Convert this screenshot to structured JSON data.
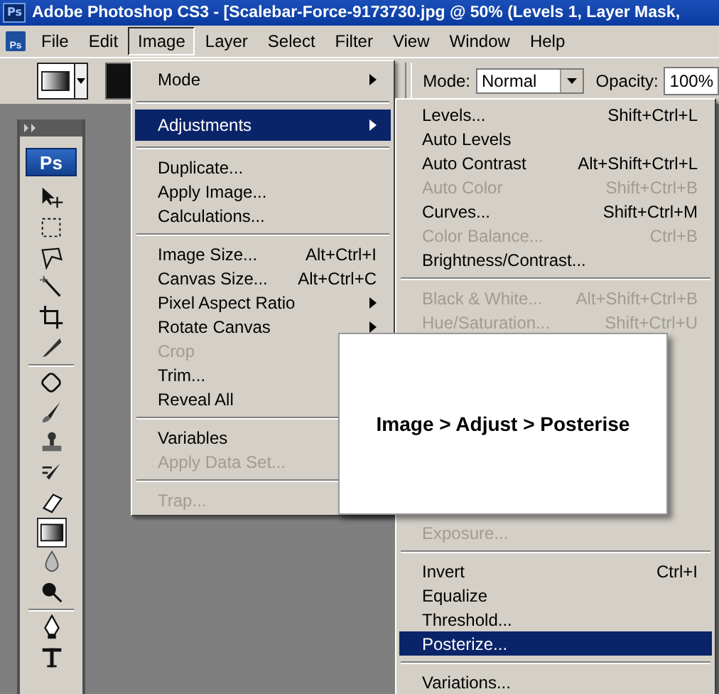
{
  "window": {
    "title": "Adobe Photoshop CS3 - [Scalebar-Force-9173730.jpg @ 50% (Levels 1, Layer Mask,",
    "icon_text": "Ps"
  },
  "menubar": {
    "icon_text": "Ps",
    "items": [
      {
        "label": "File",
        "selected": false
      },
      {
        "label": "Edit",
        "selected": false
      },
      {
        "label": "Image",
        "selected": true
      },
      {
        "label": "Layer",
        "selected": false
      },
      {
        "label": "Select",
        "selected": false
      },
      {
        "label": "Filter",
        "selected": false
      },
      {
        "label": "View",
        "selected": false
      },
      {
        "label": "Window",
        "selected": false
      },
      {
        "label": "Help",
        "selected": false
      }
    ]
  },
  "options_bar": {
    "mode_label": "Mode:",
    "mode_value": "Normal",
    "opacity_label": "Opacity:",
    "opacity_value": "100%"
  },
  "toolbox": {
    "logo": "Ps"
  },
  "image_menu": {
    "items": [
      {
        "kind": "item",
        "label": "Mode",
        "submenu": true,
        "disabled": false,
        "selected": false
      },
      {
        "kind": "separator"
      },
      {
        "kind": "item",
        "label": "Adjustments",
        "submenu": true,
        "disabled": false,
        "selected": true
      },
      {
        "kind": "separator"
      },
      {
        "kind": "item",
        "label": "Duplicate...",
        "disabled": false,
        "selected": false
      },
      {
        "kind": "item",
        "label": "Apply Image...",
        "disabled": false,
        "selected": false
      },
      {
        "kind": "item",
        "label": "Calculations...",
        "disabled": false,
        "selected": false
      },
      {
        "kind": "separator"
      },
      {
        "kind": "item",
        "label": "Image Size...",
        "shortcut": "Alt+Ctrl+I",
        "disabled": false,
        "selected": false
      },
      {
        "kind": "item",
        "label": "Canvas Size...",
        "shortcut": "Alt+Ctrl+C",
        "disabled": false,
        "selected": false
      },
      {
        "kind": "item",
        "label": "Pixel Aspect Ratio",
        "submenu": true,
        "disabled": false,
        "selected": false
      },
      {
        "kind": "item",
        "label": "Rotate Canvas",
        "submenu": true,
        "disabled": false,
        "selected": false
      },
      {
        "kind": "item",
        "label": "Crop",
        "disabled": true,
        "selected": false
      },
      {
        "kind": "item",
        "label": "Trim...",
        "disabled": false,
        "selected": false
      },
      {
        "kind": "item",
        "label": "Reveal All",
        "disabled": false,
        "selected": false
      },
      {
        "kind": "separator"
      },
      {
        "kind": "item",
        "label": "Variables",
        "disabled": false,
        "selected": false
      },
      {
        "kind": "item",
        "label": "Apply Data Set...",
        "disabled": true,
        "selected": false
      },
      {
        "kind": "separator"
      },
      {
        "kind": "item",
        "label": "Trap...",
        "disabled": true,
        "selected": false
      }
    ]
  },
  "adjustments_menu": {
    "upper_items": [
      {
        "kind": "item",
        "label": "Levels...",
        "shortcut": "Shift+Ctrl+L",
        "disabled": false,
        "selected": false
      },
      {
        "kind": "item",
        "label": "Auto Levels",
        "disabled": false,
        "selected": false
      },
      {
        "kind": "item",
        "label": "Auto Contrast",
        "shortcut": "Alt+Shift+Ctrl+L",
        "disabled": false,
        "selected": false
      },
      {
        "kind": "item",
        "label": "Auto Color",
        "shortcut": "Shift+Ctrl+B",
        "disabled": true,
        "selected": false
      },
      {
        "kind": "item",
        "label": "Curves...",
        "shortcut": "Shift+Ctrl+M",
        "disabled": false,
        "selected": false
      },
      {
        "kind": "item",
        "label": "Color Balance...",
        "shortcut": "Ctrl+B",
        "disabled": true,
        "selected": false
      },
      {
        "kind": "item",
        "label": "Brightness/Contrast...",
        "disabled": false,
        "selected": false
      },
      {
        "kind": "separator"
      },
      {
        "kind": "item",
        "label": "Black & White...",
        "shortcut": "Alt+Shift+Ctrl+B",
        "disabled": true,
        "selected": false
      },
      {
        "kind": "item",
        "label": "Hue/Saturation...",
        "shortcut": "Shift+Ctrl+U",
        "disabled": true,
        "selected": false
      }
    ],
    "lower_items": [
      {
        "kind": "item",
        "label": "Exposure...",
        "disabled": true,
        "selected": false
      },
      {
        "kind": "separator"
      },
      {
        "kind": "item",
        "label": "Invert",
        "shortcut": "Ctrl+I",
        "disabled": false,
        "selected": false
      },
      {
        "kind": "item",
        "label": "Equalize",
        "disabled": false,
        "selected": false
      },
      {
        "kind": "item",
        "label": "Threshold...",
        "disabled": false,
        "selected": false
      },
      {
        "kind": "item",
        "label": "Posterize...",
        "disabled": false,
        "selected": true
      },
      {
        "kind": "separator"
      },
      {
        "kind": "item",
        "label": "Variations...",
        "disabled": false,
        "selected": false
      }
    ]
  },
  "callout": {
    "text": "Image > Adjust > Posterise"
  }
}
